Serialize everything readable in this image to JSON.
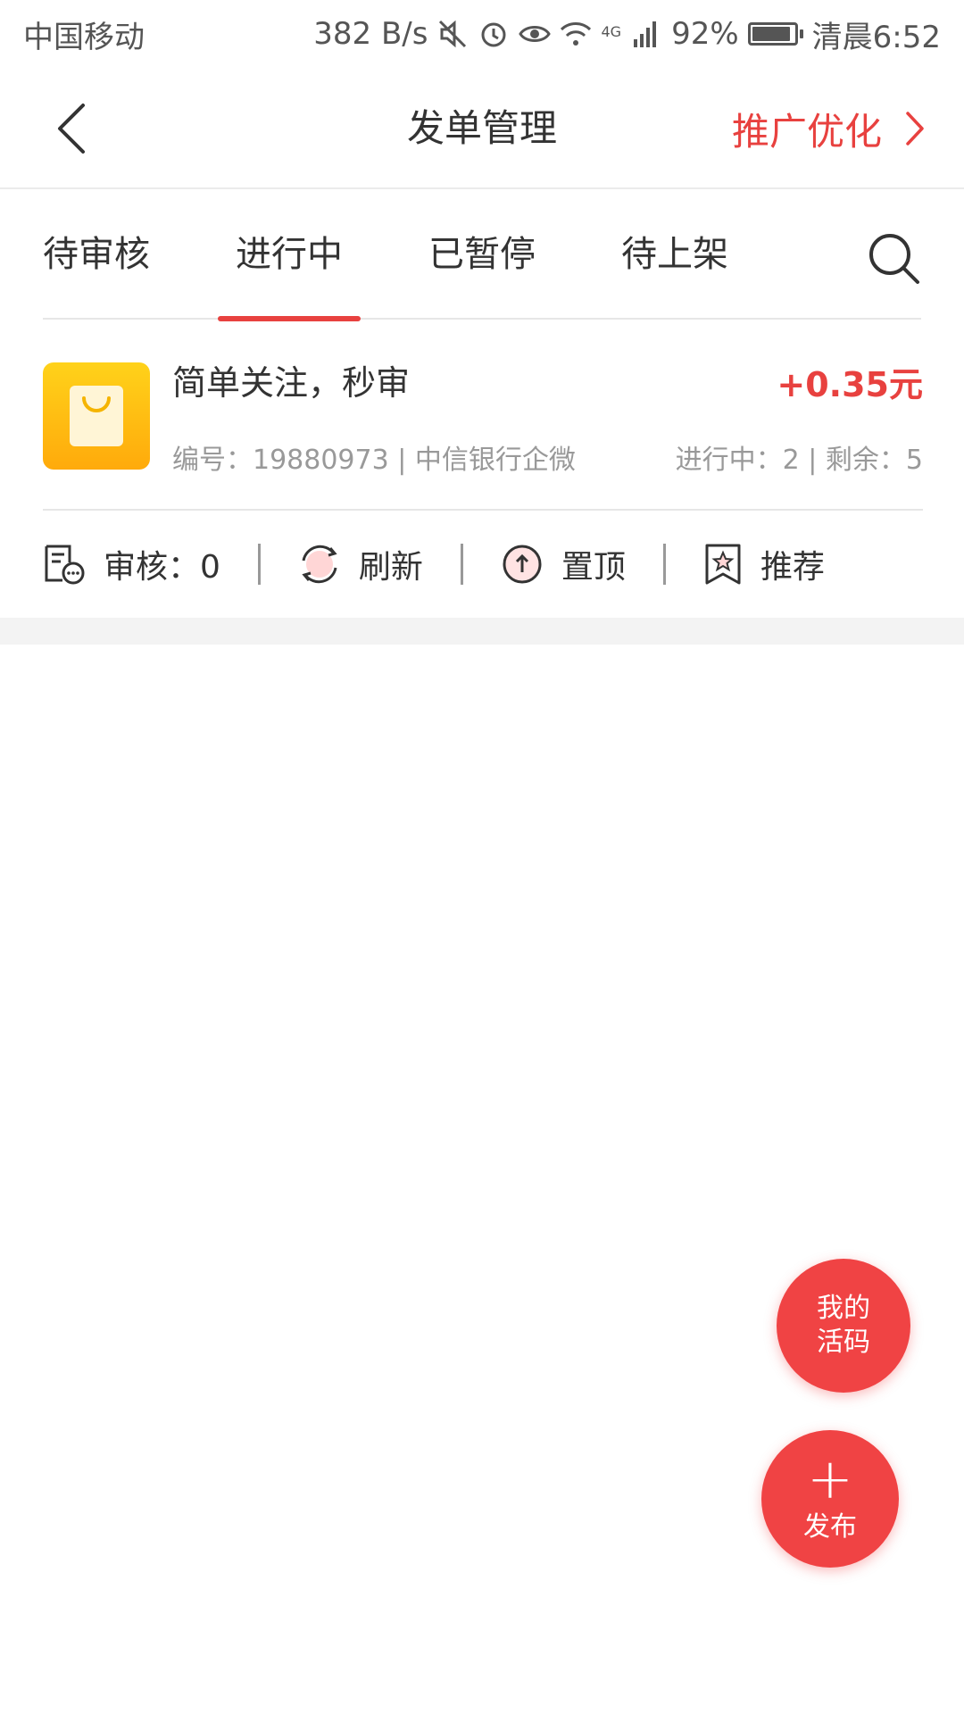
{
  "status_bar": {
    "carrier": "中国移动",
    "speed": "382 B/s",
    "network": "4G",
    "battery": "92%",
    "battery_level": 0.92,
    "time": "清晨6:52"
  },
  "header": {
    "title": "发单管理",
    "promo_label": "推广优化"
  },
  "tabs": [
    {
      "label": "待审核",
      "active": false
    },
    {
      "label": "进行中",
      "active": true
    },
    {
      "label": "已暂停",
      "active": false
    },
    {
      "label": "待上架",
      "active": false
    }
  ],
  "order": {
    "title": "简单关注，秒审",
    "price": "+0.35元",
    "meta": "编号：19880973 | 中信银行企微",
    "status": "进行中：2 | 剩余：5"
  },
  "actions": {
    "review": "审核：0",
    "refresh": "刷新",
    "pin": "置顶",
    "recommend": "推荐"
  },
  "fabs": {
    "code_line1": "我的",
    "code_line2": "活码",
    "publish_plus": "+",
    "publish": "发布"
  },
  "colors": {
    "accent": "#e8413f",
    "fab": "#f04344",
    "icon_gradient_top": "#ffd21a",
    "icon_gradient_bottom": "#ffaa0b"
  }
}
